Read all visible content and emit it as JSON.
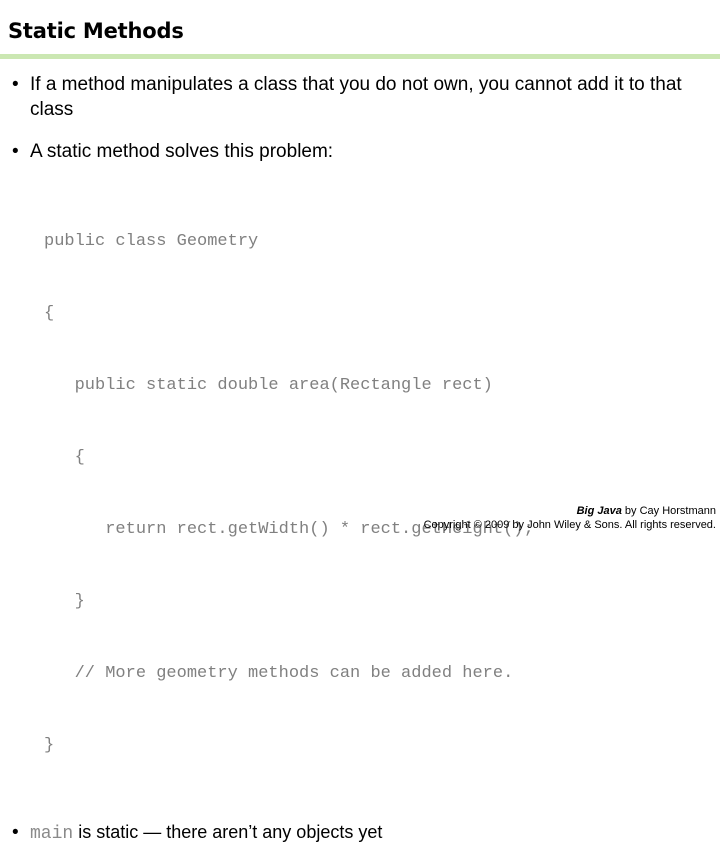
{
  "slide": {
    "title": "Static Methods",
    "accent_color": "#cbe7b2",
    "code_color": "#808080",
    "bullet_glyph": "•"
  },
  "bullets": [
    {
      "text": "If a method manipulates a class that you do not own, you cannot add it to that class"
    },
    {
      "text": "A static method solves this problem:"
    }
  ],
  "code": {
    "lines": [
      "public class Geometry",
      "{",
      "   public static double area(Rectangle rect)",
      "   {",
      "      return rect.getWidth() * rect.getHeight();",
      "   }",
      "   // More geometry methods can be added here.",
      "}"
    ]
  },
  "closing_bullet": {
    "mono_part": "main",
    "rest": " is static — there aren’t any objects yet"
  },
  "footer": {
    "book_title": "Big Java",
    "byline": " by Cay Horstmann",
    "copyright": "Copyright © 2009 by John Wiley & Sons.  All rights reserved."
  }
}
